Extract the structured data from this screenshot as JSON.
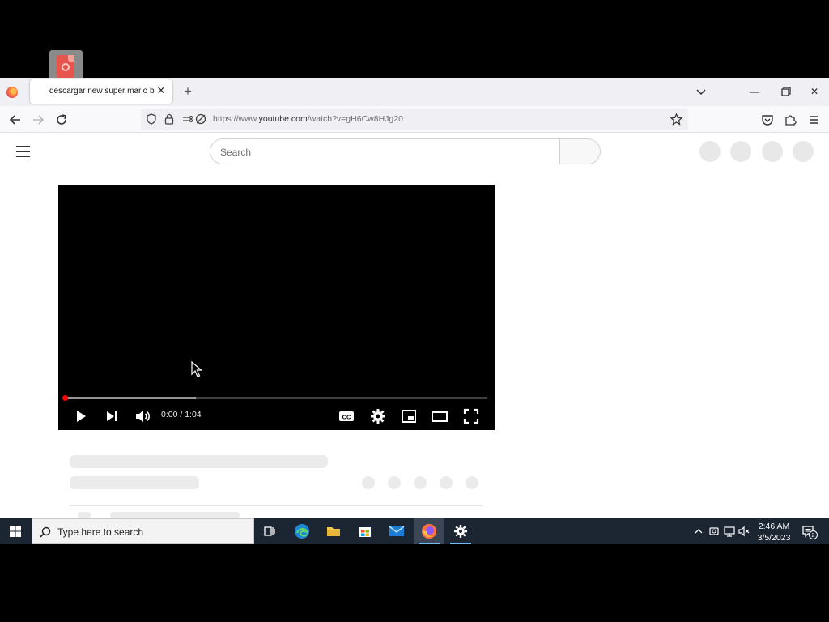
{
  "browser": {
    "tab_title": "descargar new super mario bros",
    "url_prefix": "https://www.",
    "url_domain": "youtube.com",
    "url_path": "/watch?v=gH6Cw8HJg20"
  },
  "youtube": {
    "search_placeholder": "Search"
  },
  "player": {
    "time_display": "0:00 / 1:04",
    "buffered_fraction": 0.31,
    "played_fraction": 0.0
  },
  "taskbar": {
    "search_placeholder": "Type here to search",
    "time": "2:46 AM",
    "date": "3/5/2023",
    "notification_count": "2"
  },
  "colors": {
    "taskbar_bg": "#1c2532",
    "progress_red": "#ff0000",
    "skeleton": "#ebebeb"
  }
}
